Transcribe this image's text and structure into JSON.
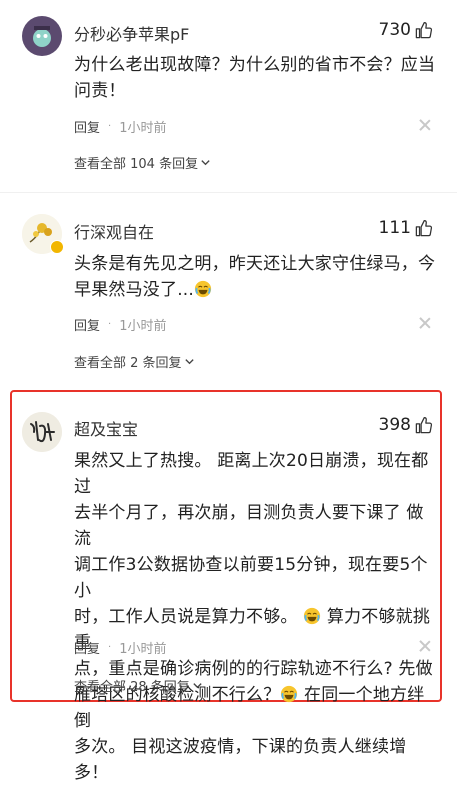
{
  "comments": [
    {
      "username": "分秒必争苹果pF",
      "likes": "730",
      "lines": [
        "为什么老出现故障？为什么别的省市不会？应当",
        "问责！"
      ],
      "reply_label": "回复",
      "dot": "·",
      "time": "1小时前",
      "view_all": "查看全部 104 条回复"
    },
    {
      "username": "行深观自在",
      "likes": "111",
      "lines": [
        "头条是有先见之明，昨天还让大家守住绿马，今",
        "早果然马没了..."
      ],
      "reply_label": "回复",
      "dot": "·",
      "time": "1小时前",
      "view_all": "查看全部 2 条回复"
    },
    {
      "username": "超及宝宝",
      "likes": "398",
      "lines": [
        "果然又上了热搜。 距离上次20日崩溃，现在都过",
        "去半个月了，再次崩，目测负责人要下课了 做流",
        "调工作3公数据协查以前要15分钟，现在要5个小",
        "时，工作人员说是算力不够。",
        "算力不够就挑重",
        "点，重点是确诊病例的的行踪轨迹不行么? 先做",
        "雁塔区的核酸检测不行么？",
        "在同一个地方绊倒",
        "多次。 目视这波疫情，下课的负责人继续增多！"
      ],
      "reply_label": "回复",
      "dot": "·",
      "time": "1小时前",
      "view_all": "查看全部 28 条回复"
    }
  ],
  "colors": {
    "highlight": "#e8332a",
    "time": "#999999",
    "text": "#222222"
  },
  "icons": {
    "like": "thumbs-up-icon",
    "close": "close-icon",
    "expand": "chevron-down-icon",
    "emoji": "crying-laughing-emoji-icon"
  }
}
